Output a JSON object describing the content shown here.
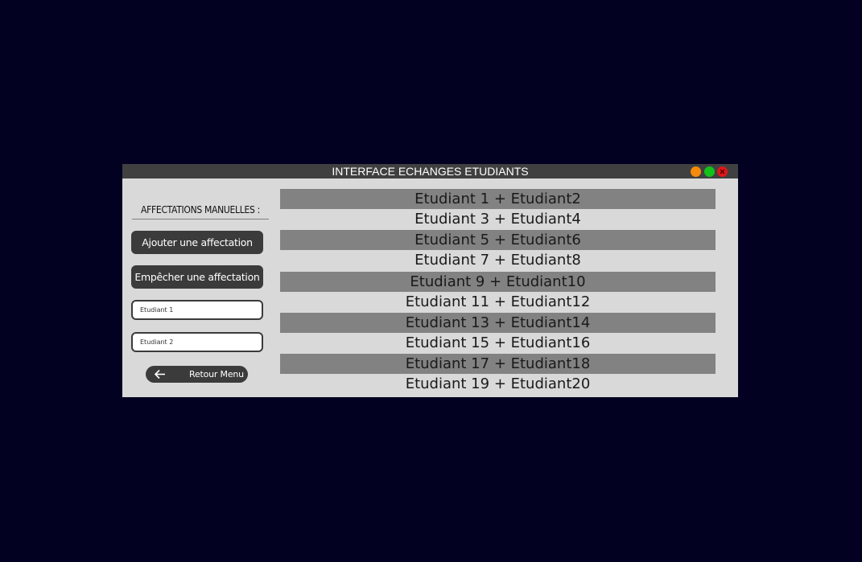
{
  "window": {
    "title": "INTERFACE ECHANGES ETUDIANTS",
    "controls": [
      "minimize",
      "maximize",
      "close"
    ],
    "colors": {
      "minimize": "#f58a0b",
      "maximize": "#12c319",
      "close": "#e01818"
    }
  },
  "sidebar": {
    "heading": "AFFECTATIONS MANUELLES :",
    "add_label": "Ajouter une affectation",
    "block_label": "Empêcher une affectation",
    "student1_placeholder": "Etudiant 1",
    "student2_placeholder": "Etudiant 2",
    "back_label": "Retour Menu",
    "back_icon": "arrow-left-icon"
  },
  "pairs": [
    "Etudiant 1 + Etudiant2",
    "Etudiant 3 + Etudiant4",
    "Etudiant 5 + Etudiant6",
    "Etudiant 7 + Etudiant8",
    "Etudiant 9 + Etudiant10",
    "Etudiant 11 + Etudiant12",
    "Etudiant 13 + Etudiant14",
    "Etudiant 15 + Etudiant16",
    "Etudiant 17 + Etudiant18",
    "Etudiant 19 + Etudiant20"
  ]
}
